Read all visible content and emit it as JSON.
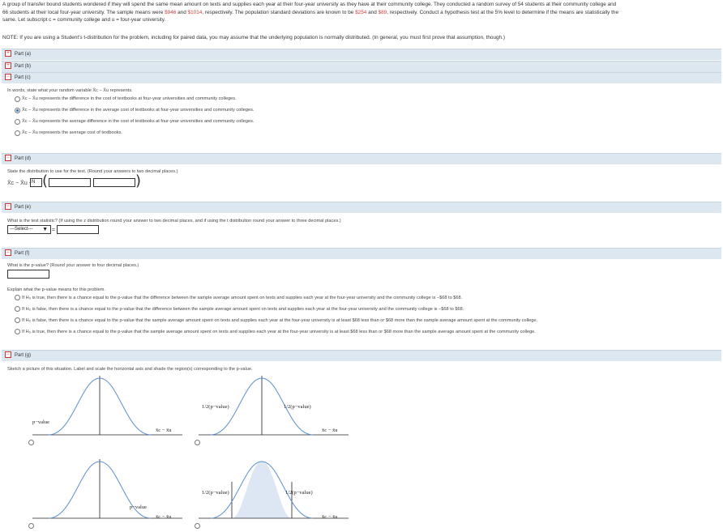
{
  "problem": {
    "line1a": "A group of transfer bound students wondered if they will spend the same mean amount on texts and supplies each year at their four-year university as they have at their community college. They conducted a random survey of 54 students at their community college and",
    "line2a": "66 students at their local four-year university. The sample means were ",
    "mean_c": "$946",
    "line2b": " and ",
    "mean_u": "$1014",
    "line2c": ", respectively. The population standard deviations are known to be ",
    "sd_c": "$254",
    "line2d": " and ",
    "sd_u": "$89",
    "line2e": ", respectively. Conduct a hypothesis test at the 5% level to determine if the means are statistically the",
    "line3": "same. Let subscript c = community college and u = four-year university.",
    "note": "NOTE: If you are using a Student's t-distribution for the problem, including for paired data, you may assume that the underlying population is normally distributed. (In general, you must first prove that assumption, though.)",
    "accent": "#d04040"
  },
  "parts": {
    "a": "Part (a)",
    "b": "Part (b)",
    "c": "Part (c)",
    "d": "Part (d)",
    "e": "Part (e)",
    "f": "Part (f)",
    "g": "Part (g)"
  },
  "part_c": {
    "prompt": "In words, state what your random variable X̄c − X̄u represents.",
    "options": [
      "X̄c − X̄u  represents the difference in the cost of textbooks at four-year universities and community colleges.",
      "X̄c − X̄u  represents the difference in the average cost of textbooks at four-year universities and community colleges.",
      "X̄c − X̄u  represents the average difference in the cost of textbooks at four-year universities and community colleges.",
      "X̄c − X̄u  represents the average cost of textbooks."
    ],
    "selected": 1
  },
  "part_d": {
    "prompt": "State the distribution to use for the test. (Round your answers to two decimal places.)",
    "var_label": "X̄c − X̄u ~",
    "dist_value": "N"
  },
  "part_e": {
    "prompt": "What is the test statistic? (If using the z distribution round your answer to two decimal places, and if using the t distribution round your answer to three decimal places.)",
    "select_value": "---Select---",
    "equals": "="
  },
  "part_f": {
    "prompt": "What is the p-value? (Round your answer to four decimal places.)",
    "explain": "Explain what the p-value means for this problem.",
    "options": [
      "If H₀ is true, then there is a chance equal to the p-value that the difference between the sample average amount spent on texts and supplies each year at the four-year university and the community college is −$68 to $68.",
      "If H₀ is false, then there is a chance equal to the p-value that the difference between the sample average amount spent on texts and supplies each year at the four-year university and the community college is −$68 to $68.",
      "If H₀ is false, then there is a chance equal to the p-value that the sample average amount spent on texts and supplies each year at the four-year university is at least $68 less than or $68 more than the sample average amount spent at the community college.",
      "If H₀ is true, then there is a chance equal to the p-value that the sample average amount spent on texts and supplies each year at the four-year university is at least $68 less than or $68 more than the sample average amount spent at the community college."
    ]
  },
  "part_g": {
    "prompt": "Sketch a picture of this situation. Label and scale the horizontal axis and shade the region(s) corresponding to the p-value.",
    "axis_label": "x̄c − x̄u",
    "pvalue_label": "p−value",
    "half_pvalue_label": "1/2(p−value)",
    "shade_color": "#dde6f3",
    "curve_color": "#5b8fd0"
  }
}
